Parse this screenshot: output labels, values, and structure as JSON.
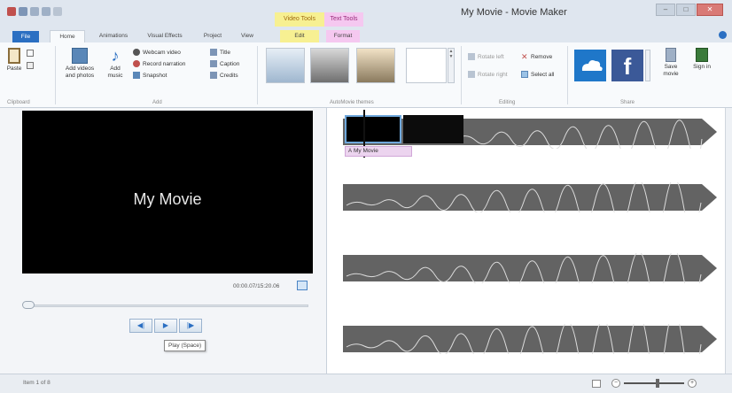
{
  "window": {
    "title": "My Movie - Movie Maker",
    "contextual_tabs": [
      "Video Tools",
      "Text Tools"
    ]
  },
  "tabs": [
    "File",
    "Home",
    "Animations",
    "Visual Effects",
    "Project",
    "View",
    "Edit",
    "Format"
  ],
  "ribbon": {
    "clipboard": {
      "paste": "Paste",
      "group": "Clipboard"
    },
    "add": {
      "add_videos": "Add videos and photos",
      "add_music": "Add music",
      "webcam": "Webcam video",
      "record": "Record narration",
      "snapshot": "Snapshot",
      "title": "Title",
      "caption": "Caption",
      "credits": "Credits",
      "group": "Add"
    },
    "themes_group": "AutoMovie themes",
    "editing": {
      "rotate_left": "Rotate left",
      "rotate_right": "Rotate right",
      "remove": "Remove",
      "select_all": "Select all",
      "group": "Editing"
    },
    "share": {
      "save_movie": "Save movie",
      "sign_in": "Sign in",
      "group": "Share"
    }
  },
  "preview": {
    "text": "My Movie",
    "timecode": "00:00.07/15:20.06",
    "tooltip": "Play (Space)"
  },
  "playback": {
    "prev": "◀|",
    "play": "▶",
    "next": "|▶"
  },
  "storyboard": {
    "caption_label": "My Movie"
  },
  "status": {
    "item": "Item 1 of 8"
  },
  "colors": {
    "accent": "#2b6fc2",
    "video_tools": "#f7f092",
    "text_tools": "#f5c8f0"
  }
}
